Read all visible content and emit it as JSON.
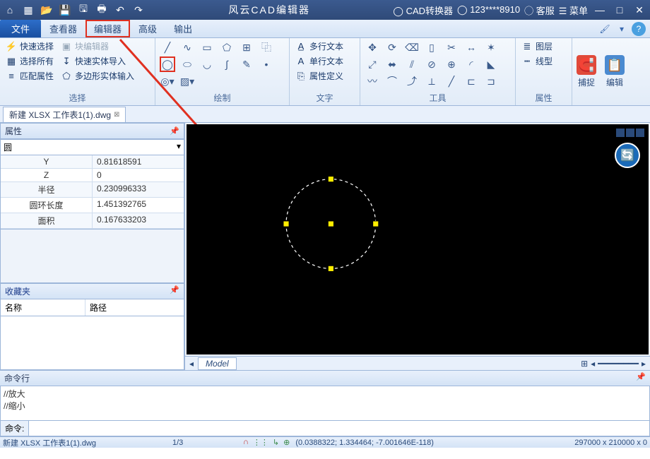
{
  "title": "风云CAD编辑器",
  "titlebar_right": {
    "convert": "CAD转换器",
    "user": "123****8910",
    "service": "客服",
    "menu": "菜单"
  },
  "menu": {
    "file": "文件",
    "viewer": "查看器",
    "editor": "编辑器",
    "advanced": "高级",
    "output": "输出"
  },
  "ribbon": {
    "select": {
      "quick": "快速选择",
      "all": "选择所有",
      "match": "匹配属性",
      "bedit": "块编辑器",
      "qimport": "快速实体导入",
      "polyimport": "多边形实体输入",
      "label": "选择"
    },
    "draw_label": "绘制",
    "text": {
      "mtext": "多行文本",
      "stext": "单行文本",
      "attdef": "属性定义",
      "label": "文字"
    },
    "tools_label": "工具",
    "layer": {
      "layers": "图层",
      "linetype": "线型",
      "label": "属性"
    },
    "snap": "捕捉",
    "edit": "编辑"
  },
  "filetab": "新建 XLSX 工作表1(1).dwg",
  "props": {
    "title": "属性",
    "selector": "圆",
    "rows": [
      {
        "k": "Y",
        "v": "0.81618591"
      },
      {
        "k": "Z",
        "v": "0"
      },
      {
        "k": "半径",
        "v": "0.230996333"
      },
      {
        "k": "圆环长度",
        "v": "1.451392765"
      },
      {
        "k": "面积",
        "v": "0.167633203"
      }
    ]
  },
  "fav": {
    "title": "收藏夹",
    "col1": "名称",
    "col2": "路径"
  },
  "model_tab": "Model",
  "cmd": {
    "title": "命令行",
    "line1": "//放大",
    "line2": "//缩小",
    "prompt": "命令:"
  },
  "status": {
    "file": "新建 XLSX 工作表1(1).dwg",
    "frac": "1/3",
    "coord": "(0.0388322; 1.334464; -7.001646E-118)",
    "dim": "297000 x 210000 x 0"
  }
}
